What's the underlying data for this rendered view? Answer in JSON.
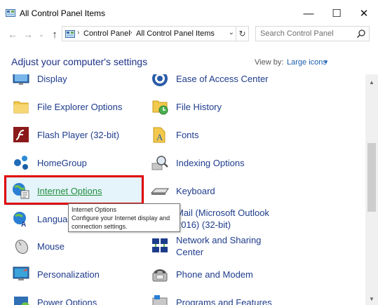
{
  "window": {
    "title": "All Control Panel Items",
    "minimize_glyph": "—",
    "maximize_glyph": "☐",
    "close_glyph": "✕"
  },
  "nav": {
    "back_glyph": "←",
    "forward_glyph": "→",
    "recent_glyph": "⌄",
    "up_glyph": "↑"
  },
  "address": {
    "crumbs": [
      "Control Panel",
      "All Control Panel Items"
    ],
    "separator": "›",
    "dropdown_glyph": "⌄",
    "refresh_glyph": "↻"
  },
  "search": {
    "placeholder": "Search Control Panel"
  },
  "header": {
    "title": "Adjust your computer's settings",
    "view_by_label": "View by:",
    "view_by_value": "Large icons",
    "view_by_caret": "▼"
  },
  "items": [
    {
      "label": "Display",
      "icon": "display-icon"
    },
    {
      "label": "Ease of Access Center",
      "icon": "ease-of-access-icon"
    },
    {
      "label": "File Explorer Options",
      "icon": "folder-options-icon"
    },
    {
      "label": "File History",
      "icon": "file-history-icon"
    },
    {
      "label": "Flash Player (32-bit)",
      "icon": "flash-player-icon"
    },
    {
      "label": "Fonts",
      "icon": "fonts-icon"
    },
    {
      "label": "HomeGroup",
      "icon": "homegroup-icon"
    },
    {
      "label": "Indexing Options",
      "icon": "indexing-icon"
    },
    {
      "label": "Internet Options",
      "icon": "internet-options-icon"
    },
    {
      "label": "Keyboard",
      "icon": "keyboard-icon"
    },
    {
      "label": "Language",
      "icon": "language-icon"
    },
    {
      "label_line1": "Mail (Microsoft Outlook",
      "label_line2": "2016) (32-bit)",
      "icon": "mail-icon"
    },
    {
      "label": "Mouse",
      "icon": "mouse-icon"
    },
    {
      "label_line1": "Network and Sharing",
      "label_line2": "Center",
      "icon": "network-sharing-icon"
    },
    {
      "label": "Personalization",
      "icon": "personalization-icon"
    },
    {
      "label": "Phone and Modem",
      "icon": "phone-modem-icon"
    },
    {
      "label": "Power Options",
      "icon": "power-options-icon"
    },
    {
      "label": "Programs and Features",
      "icon": "programs-features-icon"
    }
  ],
  "tooltip": {
    "title": "Internet Options",
    "description": "Configure your Internet display and connection settings."
  },
  "scrollbar": {
    "up_glyph": "▲",
    "down_glyph": "▼"
  },
  "colors": {
    "link": "#1e3c8c",
    "hover_link": "#1f8f3a",
    "hover_bg": "#e5f3fb",
    "highlight": "#e00000",
    "heading": "#1e3287"
  }
}
